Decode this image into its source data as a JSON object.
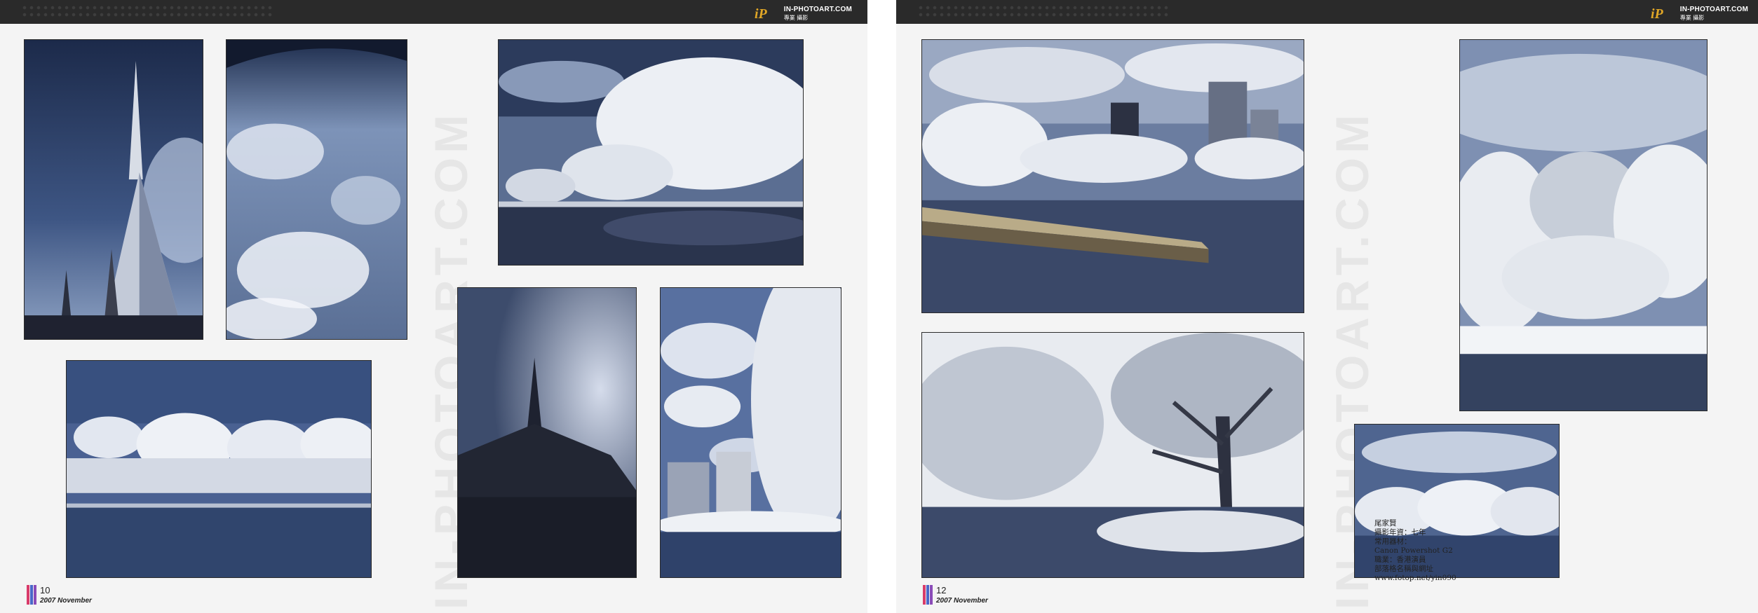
{
  "header": {
    "site_url": "IN-PHOTOART.COM",
    "site_sub": "專業 攝影",
    "logo_text": "iP",
    "accent_color": "#e0a626"
  },
  "watermark_text": "IN-PHOTOART.COM",
  "left_page": {
    "page_number": "10",
    "issue": "2007 November"
  },
  "right_page": {
    "page_number": "12",
    "issue": "2007 November"
  },
  "footer_stripe_colors": [
    "#d83b6a",
    "#4a67c8",
    "#8a4bb8"
  ],
  "credits": {
    "lines": [
      "尾家賢",
      "攝影年資：七年",
      "常用器材：",
      "Canon Powershot G2",
      "職業：香港演員",
      "部落格名稱與網址",
      "www.fotop.net/yin090"
    ]
  }
}
